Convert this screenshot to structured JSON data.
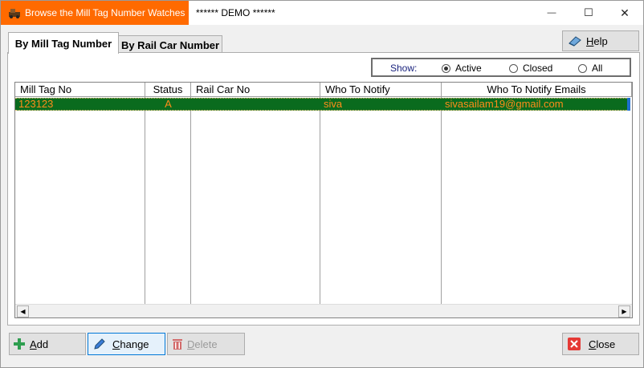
{
  "window": {
    "app_title": "Browse the Mill Tag Number Watches",
    "demo_label": "****** DEMO ******",
    "minimize_glyph": "—",
    "maximize_glyph": "☐",
    "close_glyph": "✕"
  },
  "tabs": [
    {
      "label": "By Mill Tag Number",
      "active": true
    },
    {
      "label": "By Rail Car Number",
      "active": false
    }
  ],
  "help_label": "Help",
  "show": {
    "label": "Show:",
    "options": [
      {
        "label": "Active",
        "selected": true
      },
      {
        "label": "Closed",
        "selected": false
      },
      {
        "label": "All",
        "selected": false
      }
    ]
  },
  "grid": {
    "columns": [
      "Mill Tag No",
      "Status",
      "Rail Car No",
      "Who To Notify",
      "Who To Notify Emails"
    ],
    "rows": [
      {
        "mill_tag_no": "123123",
        "status": "A",
        "rail_car_no": "",
        "who_to_notify": "siva",
        "emails": "sivasailam19@gmail.com"
      }
    ]
  },
  "buttons": {
    "add": "Add",
    "change": "Change",
    "delete": "Delete",
    "close": "Close"
  },
  "colors": {
    "title_accent": "#ff6a00",
    "selected_row_bg": "#0a6b1e",
    "selected_row_text": "#ff8c1a"
  }
}
